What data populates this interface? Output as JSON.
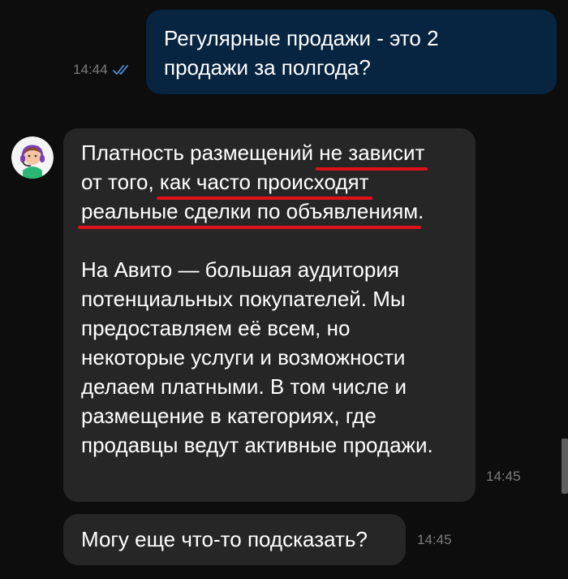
{
  "chat": {
    "outgoing": {
      "lines": [
        "Регулярные продажи - это 2",
        "продажи за полгода?"
      ],
      "time": "14:44",
      "status_icon": "double-check-read-icon"
    },
    "incoming": [
      {
        "sender_avatar_icon": "support-agent-avatar-icon",
        "lines": [
          [
            {
              "text": "Платность размещений ",
              "highlight": false
            },
            {
              "text": "не зависит",
              "highlight": true
            }
          ],
          [
            {
              "text": "от того, ",
              "highlight": false
            },
            {
              "text": "как часто происходят",
              "highlight": true
            }
          ],
          [
            {
              "text": "реальные сделки по объявлениям",
              "highlight": true
            },
            {
              "text": ".",
              "highlight": false
            }
          ],
          [],
          [
            {
              "text": "На Авито — большая аудитория",
              "highlight": false
            }
          ],
          [
            {
              "text": "потенциальных покупателей. Мы",
              "highlight": false
            }
          ],
          [
            {
              "text": "предоставляем её всем, но",
              "highlight": false
            }
          ],
          [
            {
              "text": "некоторые услуги и возможности",
              "highlight": false
            }
          ],
          [
            {
              "text": "делаем платными. В том числе и",
              "highlight": false
            }
          ],
          [
            {
              "text": "размещение в категориях, где",
              "highlight": false
            }
          ],
          [
            {
              "text": "продавцы ведут активные продажи.",
              "highlight": false
            }
          ]
        ],
        "time": "14:45"
      },
      {
        "lines": [
          [
            {
              "text": "Могу еще что-то подсказать?",
              "highlight": false
            }
          ]
        ],
        "time": "14:45"
      }
    ]
  },
  "colors": {
    "background": "#0d0d0d",
    "outgoing_bubble": "#072441",
    "incoming_bubble": "#262626",
    "check_mark": "#4a90d9",
    "timestamp": "#7d7d7d",
    "highlight_underline": "#e0101a"
  }
}
